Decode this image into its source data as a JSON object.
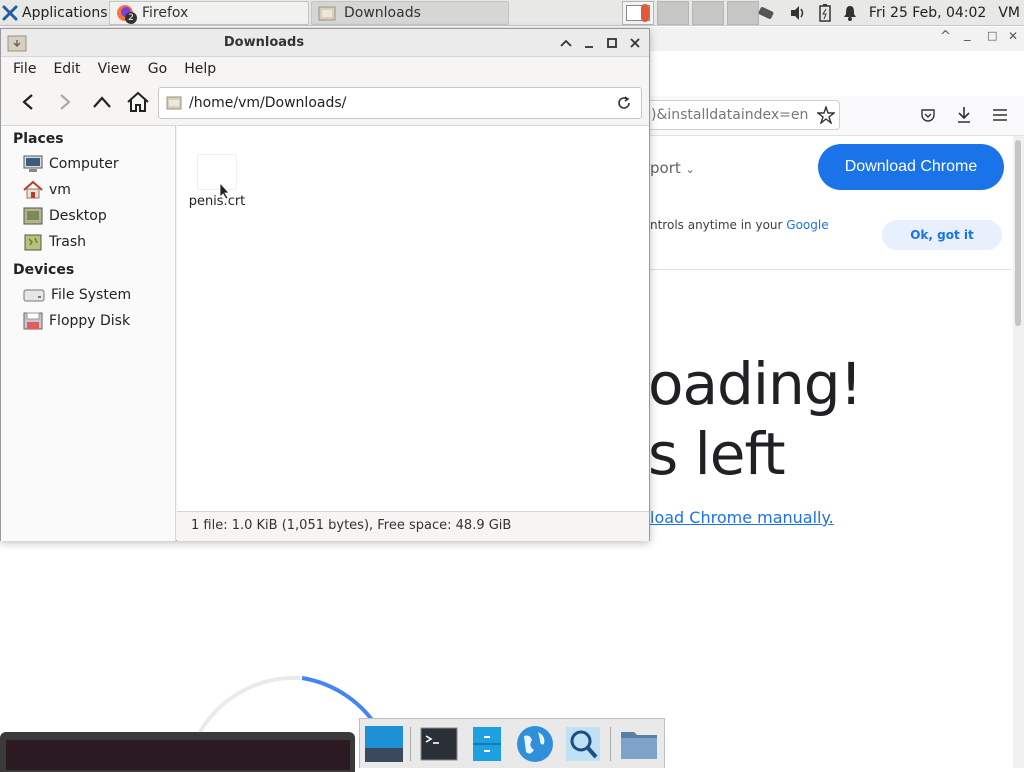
{
  "panel": {
    "applications_label": "Applications",
    "tasks": [
      {
        "label": "Firefox",
        "badge": "2"
      },
      {
        "label": "Downloads"
      }
    ],
    "clock": "Fri 25 Feb, 04:02",
    "user": "VM"
  },
  "firefox": {
    "url_fragment": ")&installdataindex=en",
    "nav_fragment": "port",
    "download_button": "Download Chrome",
    "cookie_text": "ntrols anytime in your",
    "cookie_link": "Google",
    "ok_button": "Ok, got it",
    "heading_line1": "oading!",
    "heading_line2": "s left",
    "manual_link": "load Chrome manually."
  },
  "thunar": {
    "title": "Downloads",
    "menu": [
      "File",
      "Edit",
      "View",
      "Go",
      "Help"
    ],
    "location": "/home/vm/Downloads/",
    "places_header": "Places",
    "places": [
      "Computer",
      "vm",
      "Desktop",
      "Trash"
    ],
    "devices_header": "Devices",
    "devices": [
      "File System",
      "Floppy Disk"
    ],
    "files": [
      {
        "name": "penis.crt"
      }
    ],
    "status": "1 file: 1.0 KiB (1,051 bytes), Free space: 48.9 GiB"
  },
  "colors": {
    "accent": "#1a73e8",
    "panel_bg": "#e8e8e7",
    "window_bg": "#f6f5f4"
  }
}
